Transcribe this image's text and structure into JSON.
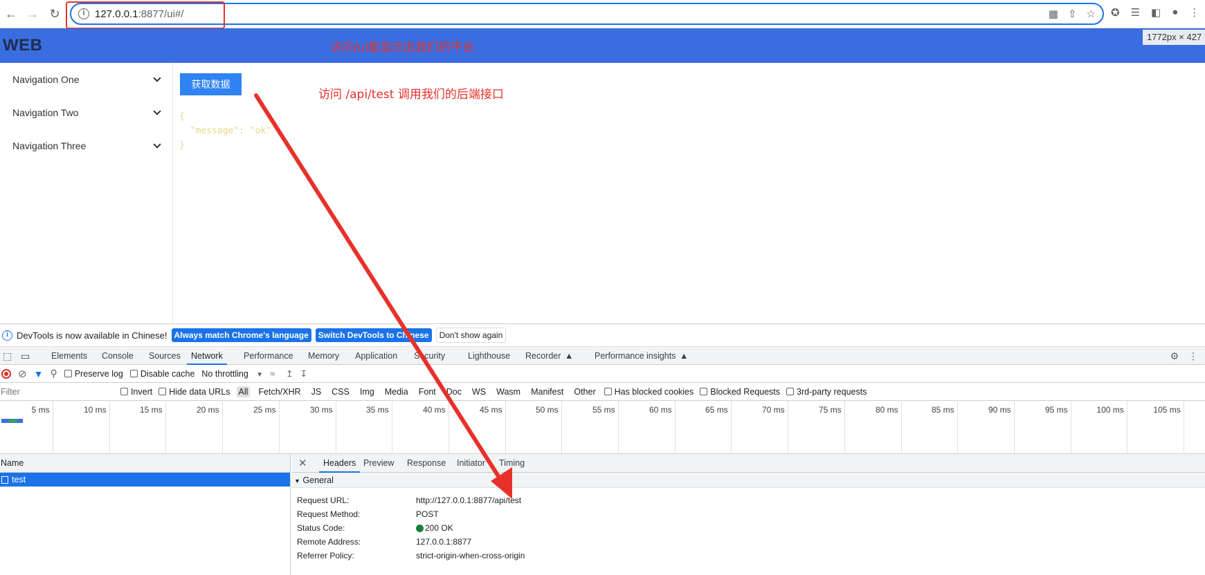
{
  "browser": {
    "url_host": "127.0.0.1",
    "url_rest": ":8877/ui#/",
    "back_icon": "arrow-left",
    "forward_icon": "arrow-right",
    "reload_icon": "reload"
  },
  "app": {
    "logo": "WEB",
    "annotation_header": "访问/ui能显示出我们的平台",
    "size_badge": "1772px × 427"
  },
  "sidebar": {
    "items": [
      {
        "label": "Navigation One"
      },
      {
        "label": "Navigation Two"
      },
      {
        "label": "Navigation Three"
      }
    ]
  },
  "main": {
    "fetch_button": "获取数据",
    "annotation_api": "访问 /api/test 调用我们的后端接口",
    "json_output": "{\n  \"message\": \"ok\"\n}"
  },
  "devtools": {
    "infobar": {
      "text": "DevTools is now available in Chinese!",
      "btn_match": "Always match Chrome's language",
      "btn_switch": "Switch DevTools to Chinese",
      "btn_dismiss": "Don't show again"
    },
    "tabs": [
      "Elements",
      "Console",
      "Sources",
      "Network",
      "Performance",
      "Memory",
      "Application",
      "Security",
      "Lighthouse",
      "Recorder",
      "Performance insights"
    ],
    "toolbar": {
      "preserve_log": "Preserve log",
      "disable_cache": "Disable cache",
      "throttling": "No throttling"
    },
    "filter": {
      "placeholder": "Filter",
      "invert": "Invert",
      "hide_data_urls": "Hide data URLs",
      "types": [
        "All",
        "Fetch/XHR",
        "JS",
        "CSS",
        "Img",
        "Media",
        "Font",
        "Doc",
        "WS",
        "Wasm",
        "Manifest",
        "Other"
      ],
      "has_blocked_cookies": "Has blocked cookies",
      "blocked_requests": "Blocked Requests",
      "third_party": "3rd-party requests"
    },
    "timeline_ticks": [
      "5 ms",
      "10 ms",
      "15 ms",
      "20 ms",
      "25 ms",
      "30 ms",
      "35 ms",
      "40 ms",
      "45 ms",
      "50 ms",
      "55 ms",
      "60 ms",
      "65 ms",
      "70 ms",
      "75 ms",
      "80 ms",
      "85 ms",
      "90 ms",
      "95 ms",
      "100 ms",
      "105 ms"
    ],
    "requests": {
      "header": "Name",
      "rows": [
        {
          "name": "test"
        }
      ]
    },
    "detail": {
      "tabs": [
        "Headers",
        "Preview",
        "Response",
        "Initiator",
        "Timing"
      ],
      "general_title": "General",
      "rows": [
        {
          "key": "Request URL:",
          "value": "http://127.0.0.1:8877/api/test"
        },
        {
          "key": "Request Method:",
          "value": "POST"
        },
        {
          "key": "Status Code:",
          "value": "200 OK"
        },
        {
          "key": "Remote Address:",
          "value": "127.0.0.1:8877"
        },
        {
          "key": "Referrer Policy:",
          "value": "strict-origin-when-cross-origin"
        }
      ]
    }
  },
  "colors": {
    "header_blue": "#3a6ee0",
    "annotation_red": "#e8302a",
    "accent_blue": "#1a73e8",
    "status_green": "#188038"
  }
}
